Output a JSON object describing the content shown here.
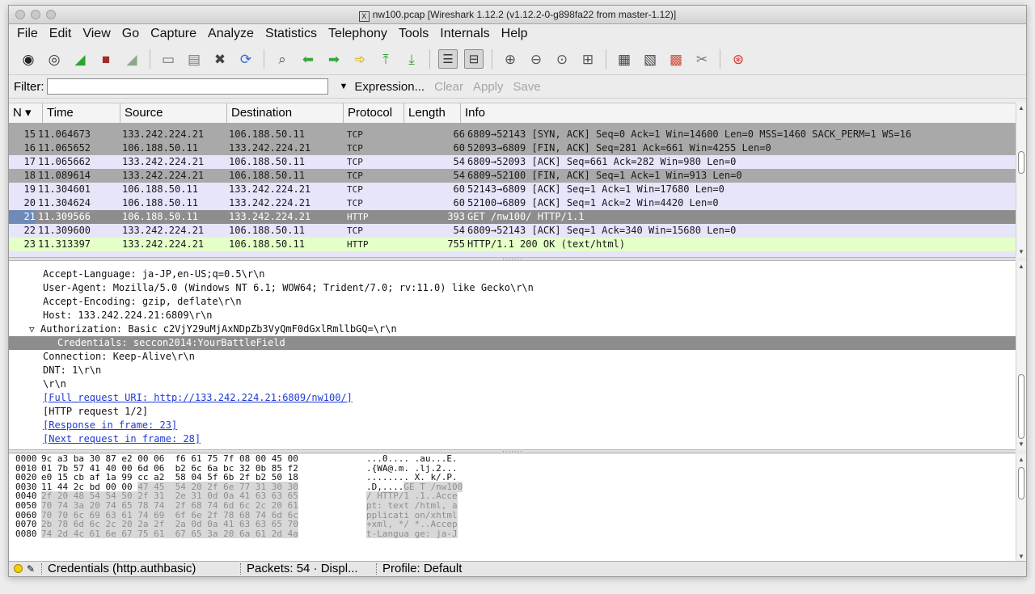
{
  "window": {
    "title": "nw100.pcap  [Wireshark 1.12.2  (v1.12.2-0-g898fa22 from master-1.12)]"
  },
  "menu": [
    "File",
    "Edit",
    "View",
    "Go",
    "Capture",
    "Analyze",
    "Statistics",
    "Telephony",
    "Tools",
    "Internals",
    "Help"
  ],
  "filter": {
    "label": "Filter:",
    "value": "",
    "expression": "Expression...",
    "clear": "Clear",
    "apply": "Apply",
    "save": "Save"
  },
  "packet_columns": [
    "N ▾",
    "Time",
    "Source",
    "Destination",
    "Protocol",
    "Length",
    "Info"
  ],
  "packets": [
    {
      "no": "15",
      "time": "11.064673",
      "src": "133.242.224.21",
      "dst": "106.188.50.11",
      "proto": "TCP",
      "len": "66",
      "info": "6809→52143 [SYN, ACK] Seq=0 Ack=1 Win=14600 Len=0 MSS=1460 SACK_PERM=1 WS=16"
    },
    {
      "no": "16",
      "time": "11.065652",
      "src": "106.188.50.11",
      "dst": "133.242.224.21",
      "proto": "TCP",
      "len": "60",
      "info": "52093→6809 [FIN, ACK] Seq=281 Ack=661 Win=4255 Len=0"
    },
    {
      "no": "17",
      "time": "11.065662",
      "src": "133.242.224.21",
      "dst": "106.188.50.11",
      "proto": "TCP",
      "len": "54",
      "info": "6809→52093 [ACK] Seq=661 Ack=282 Win=980 Len=0"
    },
    {
      "no": "18",
      "time": "11.089614",
      "src": "133.242.224.21",
      "dst": "106.188.50.11",
      "proto": "TCP",
      "len": "54",
      "info": "6809→52100 [FIN, ACK] Seq=1 Ack=1 Win=913 Len=0"
    },
    {
      "no": "19",
      "time": "11.304601",
      "src": "106.188.50.11",
      "dst": "133.242.224.21",
      "proto": "TCP",
      "len": "60",
      "info": "52143→6809 [ACK] Seq=1 Ack=1 Win=17680 Len=0"
    },
    {
      "no": "20",
      "time": "11.304624",
      "src": "106.188.50.11",
      "dst": "133.242.224.21",
      "proto": "TCP",
      "len": "60",
      "info": "52100→6809 [ACK] Seq=1 Ack=2 Win=4420 Len=0"
    },
    {
      "no": "21",
      "time": "11.309566",
      "src": "106.188.50.11",
      "dst": "133.242.224.21",
      "proto": "HTTP",
      "len": "393",
      "info": "GET /nw100/ HTTP/1.1"
    },
    {
      "no": "22",
      "time": "11.309600",
      "src": "133.242.224.21",
      "dst": "106.188.50.11",
      "proto": "TCP",
      "len": "54",
      "info": "6809→52143 [ACK] Seq=1 Ack=340 Win=15680 Len=0"
    },
    {
      "no": "23",
      "time": "11.313397",
      "src": "133.242.224.21",
      "dst": "106.188.50.11",
      "proto": "HTTP",
      "len": "755",
      "info": "HTTP/1.1 200 OK  (text/html)"
    }
  ],
  "details": [
    "Accept-Language: ja-JP,en-US;q=0.5\\r\\n",
    "User-Agent: Mozilla/5.0 (Windows NT 6.1; WOW64; Trident/7.0; rv:11.0) like Gecko\\r\\n",
    "Accept-Encoding: gzip, deflate\\r\\n",
    "Host: 133.242.224.21:6809\\r\\n",
    "Authorization: Basic c2VjY29uMjAxNDpZb3VyQmF0dGxlRmllbGQ=\\r\\n",
    "Credentials: seccon2014:YourBattleField",
    "Connection: Keep-Alive\\r\\n",
    "DNT: 1\\r\\n",
    "\\r\\n",
    "[Full request URI: http://133.242.224.21:6809/nw100/]",
    "[HTTP request 1/2]",
    "[Response in frame: 23]",
    "[Next request in frame: 28]"
  ],
  "hex": [
    {
      "off": "0000",
      "bytes": "9c a3 ba 30 87 e2 00 06  f6 61 75 7f 08 00 45 00",
      "ascii": "...0.... .au...E."
    },
    {
      "off": "0010",
      "bytes": "01 7b 57 41 40 00 6d 06  b2 6c 6a bc 32 0b 85 f2",
      "ascii": ".{WA@.m. .lj.2..."
    },
    {
      "off": "0020",
      "bytes": "e0 15 cb af 1a 99 cc a2  58 04 5f 6b 2f b2 50 18",
      "ascii": "........ X._k/.P."
    },
    {
      "off": "0030",
      "bytes": "11 44 2c bd 00 00 ",
      "bytes_hl": "47 45  54 20 2f 6e 77 31 30 30",
      "ascii": ".D,....",
      "ascii_hl": "GE T /nw100"
    },
    {
      "off": "0040",
      "bytes": "",
      "bytes_hl": "2f 20 48 54 54 50 2f 31  2e 31 0d 0a 41 63 63 65",
      "ascii": "",
      "ascii_hl": "/ HTTP/1 .1..Acce"
    },
    {
      "off": "0050",
      "bytes": "",
      "bytes_hl": "70 74 3a 20 74 65 78 74  2f 68 74 6d 6c 2c 20 61",
      "ascii": "",
      "ascii_hl": "pt: text /html, a"
    },
    {
      "off": "0060",
      "bytes": "",
      "bytes_hl": "70 70 6c 69 63 61 74 69  6f 6e 2f 78 68 74 6d 6c",
      "ascii": "",
      "ascii_hl": "pplicati on/xhtml"
    },
    {
      "off": "0070",
      "bytes": "",
      "bytes_hl": "2b 78 6d 6c 2c 20 2a 2f  2a 0d 0a 41 63 63 65 70",
      "ascii": "",
      "ascii_hl": "+xml, */ *..Accep"
    },
    {
      "off": "0080",
      "bytes": "",
      "bytes_hl": "74 2d 4c 61 6e 67 75 61  67 65 3a 20 6a 61 2d 4a",
      "ascii": "",
      "ascii_hl": "t-Langua ge: ja-J"
    }
  ],
  "status": {
    "field": "Credentials (http.authbasic)",
    "packets": "Packets: 54 · Displ...",
    "profile": "Profile: Default"
  },
  "colors": {
    "row_dark": "#a9a9a9",
    "row_lavender": "#e6e5fa",
    "row_green": "#e4ffc7",
    "row_selected": "#8d8d8d",
    "link": "#1f3bd6"
  }
}
